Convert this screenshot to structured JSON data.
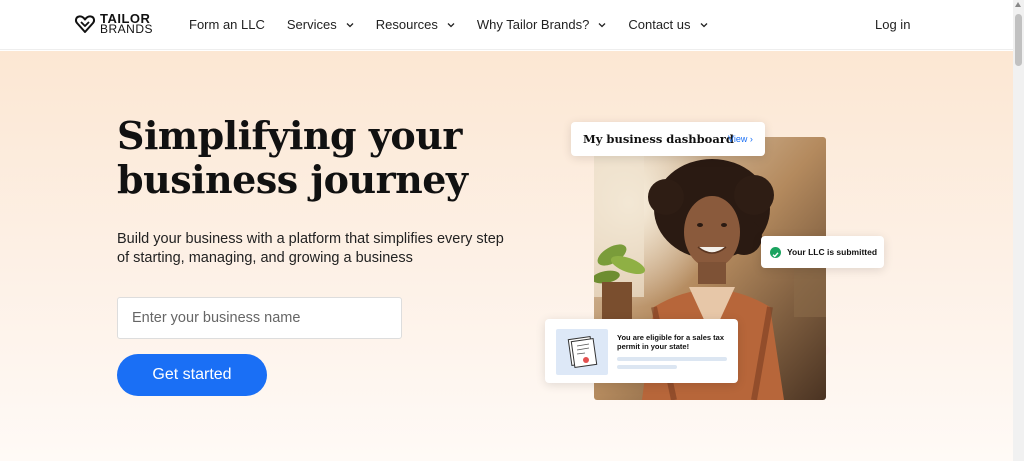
{
  "brand": {
    "line1": "TAILOR",
    "line2": "BRANDS"
  },
  "nav": {
    "items": [
      {
        "label": "Form an LLC",
        "has_dropdown": false
      },
      {
        "label": "Services",
        "has_dropdown": true
      },
      {
        "label": "Resources",
        "has_dropdown": true
      },
      {
        "label": "Why Tailor Brands?",
        "has_dropdown": true
      },
      {
        "label": "Contact us",
        "has_dropdown": true
      }
    ],
    "login_label": "Log in"
  },
  "hero": {
    "headline": "Simplifying your business journey",
    "subtitle": "Build your business with a platform that simplifies every step of starting, managing, and growing a business",
    "input_placeholder": "Enter your business name",
    "cta_label": "Get started"
  },
  "visual": {
    "dashboard_title": "My business dashboard",
    "dashboard_link": "View",
    "llc_status": "Your LLC is submitted",
    "permit_text": "You are eligible for a sales tax permit in your state!"
  },
  "colors": {
    "accent": "#1a6ff5",
    "hero_bg_top": "#fce7d3",
    "success": "#1aa35f"
  }
}
